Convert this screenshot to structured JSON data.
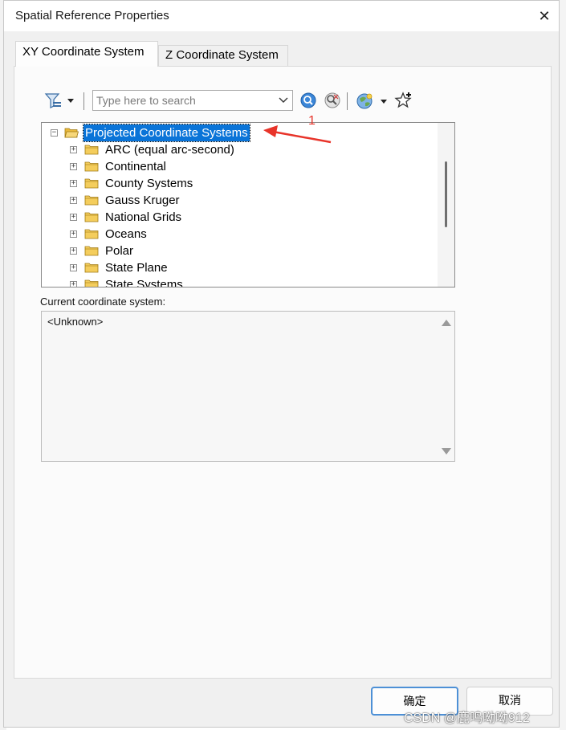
{
  "window": {
    "title": "Spatial Reference Properties",
    "close_glyph": "✕"
  },
  "tabs": [
    {
      "label": "XY Coordinate System",
      "active": true
    },
    {
      "label": "Z Coordinate System",
      "active": false
    }
  ],
  "toolbar": {
    "filter_icon": "filter-icon",
    "search_placeholder": "Type here to search",
    "search_value": "",
    "buttons": [
      "search-icon",
      "clear-search-icon",
      "globe-icon",
      "add-favorite-icon"
    ]
  },
  "tree": {
    "root": {
      "label": "Projected Coordinate Systems",
      "expanded": true,
      "selected": true,
      "expander": "−"
    },
    "children": [
      {
        "label": "ARC (equal arc-second)",
        "expander": "+"
      },
      {
        "label": "Continental",
        "expander": "+"
      },
      {
        "label": "County Systems",
        "expander": "+"
      },
      {
        "label": "Gauss Kruger",
        "expander": "+"
      },
      {
        "label": "National Grids",
        "expander": "+"
      },
      {
        "label": "Oceans",
        "expander": "+"
      },
      {
        "label": "Polar",
        "expander": "+"
      },
      {
        "label": "State Plane",
        "expander": "+"
      },
      {
        "label": "State Systems",
        "expander": "+"
      }
    ]
  },
  "current": {
    "label": "Current coordinate system:",
    "value": "<Unknown>"
  },
  "buttons": {
    "ok": "确定",
    "cancel": "取消"
  },
  "annotation": {
    "number": "1",
    "color": "#e8342a"
  },
  "watermark": "CSDN @鹿鸣呦呦912",
  "colors": {
    "selection": "#0a74d8",
    "ok_border": "#4d90d6",
    "folder": "#f2c94c"
  }
}
